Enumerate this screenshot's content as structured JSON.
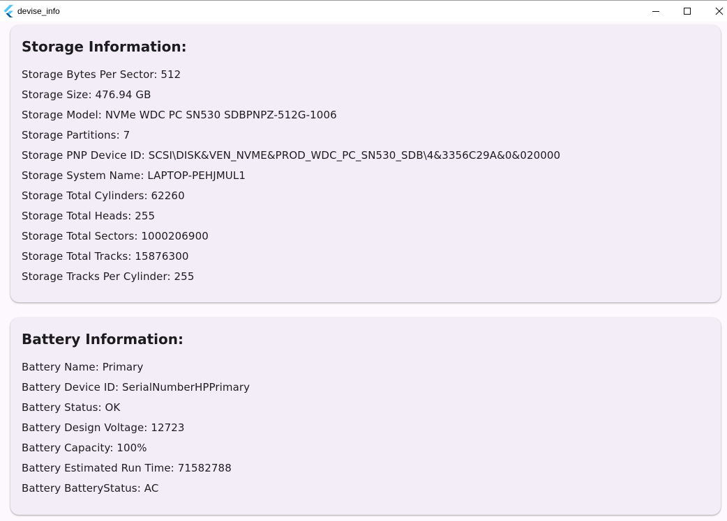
{
  "window": {
    "title": "devise_info",
    "icons": {
      "app": "flutter-logo-icon",
      "minimize": "minimize-icon",
      "maximize": "maximize-icon",
      "close": "close-icon"
    }
  },
  "storage": {
    "title": "Storage Information:",
    "rows": [
      "Storage Bytes Per Sector: 512",
      "Storage Size: 476.94 GB",
      "Storage Model: NVMe WDC PC SN530 SDBPNPZ-512G-1006",
      "Storage Partitions: 7",
      "Storage PNP Device ID: SCSI\\DISK&VEN_NVME&PROD_WDC_PC_SN530_SDB\\4&3356C29A&0&020000",
      "Storage System Name: LAPTOP-PEHJMUL1",
      "Storage Total Cylinders: 62260",
      "Storage Total Heads: 255",
      "Storage Total Sectors: 1000206900",
      "Storage Total Tracks: 15876300",
      "Storage Tracks Per Cylinder: 255"
    ]
  },
  "battery": {
    "title": "Battery Information:",
    "rows": [
      "Battery Name: Primary",
      "Battery Device ID: SerialNumberHPPrimary",
      "Battery Status: OK",
      "Battery Design Voltage: 12723",
      "Battery Capacity: 100%",
      "Battery Estimated Run Time: 71582788",
      "Battery BatteryStatus: AC"
    ]
  },
  "colors": {
    "background": "#fdf8fd",
    "card": "#f3edf7",
    "text": "#1c1b1f",
    "flutter_light": "#54c5f8",
    "flutter_dark": "#01579b"
  }
}
